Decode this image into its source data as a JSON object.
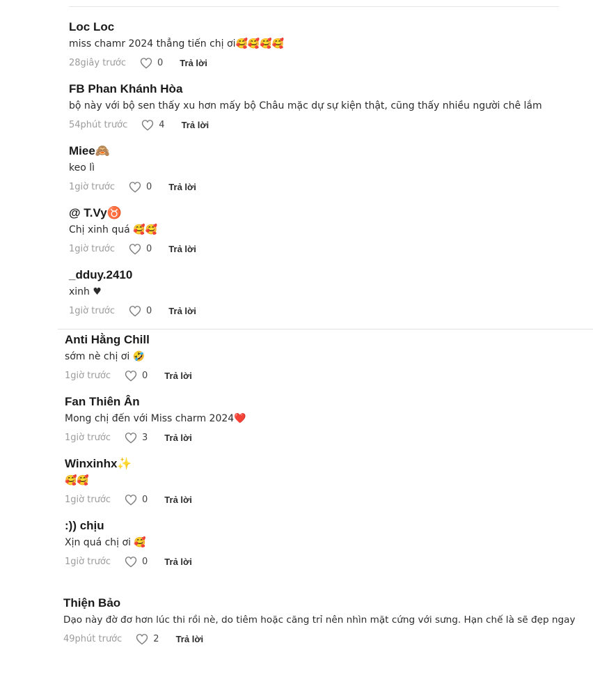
{
  "comments": [
    {
      "name": "Loc Loc",
      "text": "miss chamr 2024 thẳng tiến chị ơi🥰🥰🥰🥰",
      "time": "28giây trước",
      "likes": "0",
      "reply": "Trả lời"
    },
    {
      "name": "FB Phan Khánh Hòa",
      "text": "bộ này với bộ sen thấy xu hơn mấy bộ Châu mặc dự sự kiện thật, cũng thấy nhiều người chê lắm",
      "time": "54phút trước",
      "likes": "4",
      "reply": "Trả lời"
    },
    {
      "name": "Miee🙈",
      "text": "keo lì",
      "time": "1giờ trước",
      "likes": "0",
      "reply": "Trả lời"
    },
    {
      "name": "@ T.Vy♉",
      "text": "Chị xinh quá 🥰🥰",
      "time": "1giờ trước",
      "likes": "0",
      "reply": "Trả lời"
    },
    {
      "name": "_dduy.2410",
      "text": "xinh ♥",
      "time": "1giờ trước",
      "likes": "0",
      "reply": "Trả lời"
    },
    {
      "name": "Anti Hằng Chill",
      "text": "sớm nè chị ơi 🤣",
      "time": "1giờ trước",
      "likes": "0",
      "reply": "Trả lời"
    },
    {
      "name": "Fan Thiên Ân",
      "text": "Mong chị đến với Miss charm 2024❤️",
      "time": "1giờ trước",
      "likes": "3",
      "reply": "Trả lời"
    },
    {
      "name": "Winxinhx✨",
      "text": "🥰🥰",
      "time": "1giờ trước",
      "likes": "0",
      "reply": "Trả lời"
    },
    {
      "name": ":)) chịu",
      "text": "Xịn quá chị ơi 🥰",
      "time": "1giờ trước",
      "likes": "0",
      "reply": "Trả lời"
    },
    {
      "name": "Thiện Bảo",
      "text": "Dạo này đờ đơ hơn lúc thi rồi nè, do tiêm hoặc căng trỉ nên nhìn mặt cứng với sưng. Hạn chế là sẽ đẹp ngay",
      "time": "49phút trước",
      "likes": "2",
      "reply": "Trả lời"
    }
  ],
  "colors": {
    "name": "#1a1a1a",
    "meta": "#9b9b9b",
    "divider": "#e6e6e6"
  },
  "icons": {
    "like": "heart-outline-icon"
  }
}
